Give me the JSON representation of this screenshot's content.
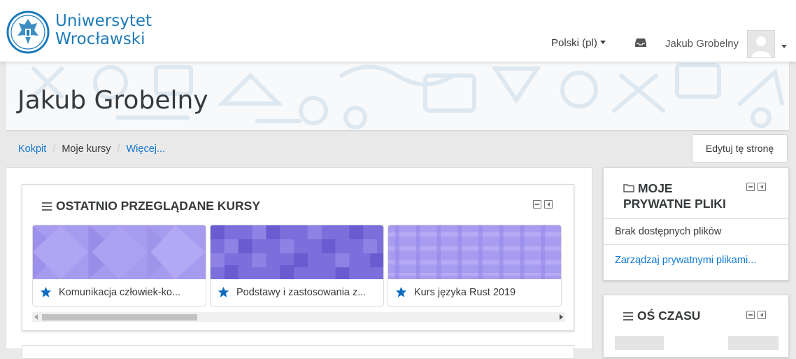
{
  "navbar": {
    "logo_line1": "Uniwersytet",
    "logo_line2": "Wrocławski",
    "language": "Polski (pl)",
    "username": "Jakub Grobelny",
    "icons": {
      "messages": "inbox-tray-icon",
      "avatar": "user-avatar",
      "dropdown": "caret-down-icon"
    }
  },
  "header": {
    "title": "Jakub Grobelny"
  },
  "breadcrumb": {
    "items": [
      "Kokpit",
      "Moje kursy",
      "Więcej..."
    ]
  },
  "edit_button": "Edytuj tę stronę",
  "recent_courses": {
    "title": "OSTATNIO PRZEGLĄDANE KURSY",
    "courses": [
      {
        "name": "Komunikacja człowiek-ko...",
        "color": "#a79bf0"
      },
      {
        "name": "Podstawy i zastosowania z...",
        "color": "#7d6fdb"
      },
      {
        "name": "Kurs języka Rust 2019",
        "color": "#a89cf0"
      }
    ]
  },
  "private_files": {
    "title_line1": "MOJE",
    "title_line2": "PRYWATNE PLIKI",
    "empty_text": "Brak dostępnych plików",
    "manage_link": "Zarządzaj prywatnymi plikami..."
  },
  "timeline": {
    "title": "OŚ CZASU"
  },
  "colors": {
    "link": "#1177d1",
    "star": "#0f6cbf",
    "logo": "#1d7ab8"
  }
}
